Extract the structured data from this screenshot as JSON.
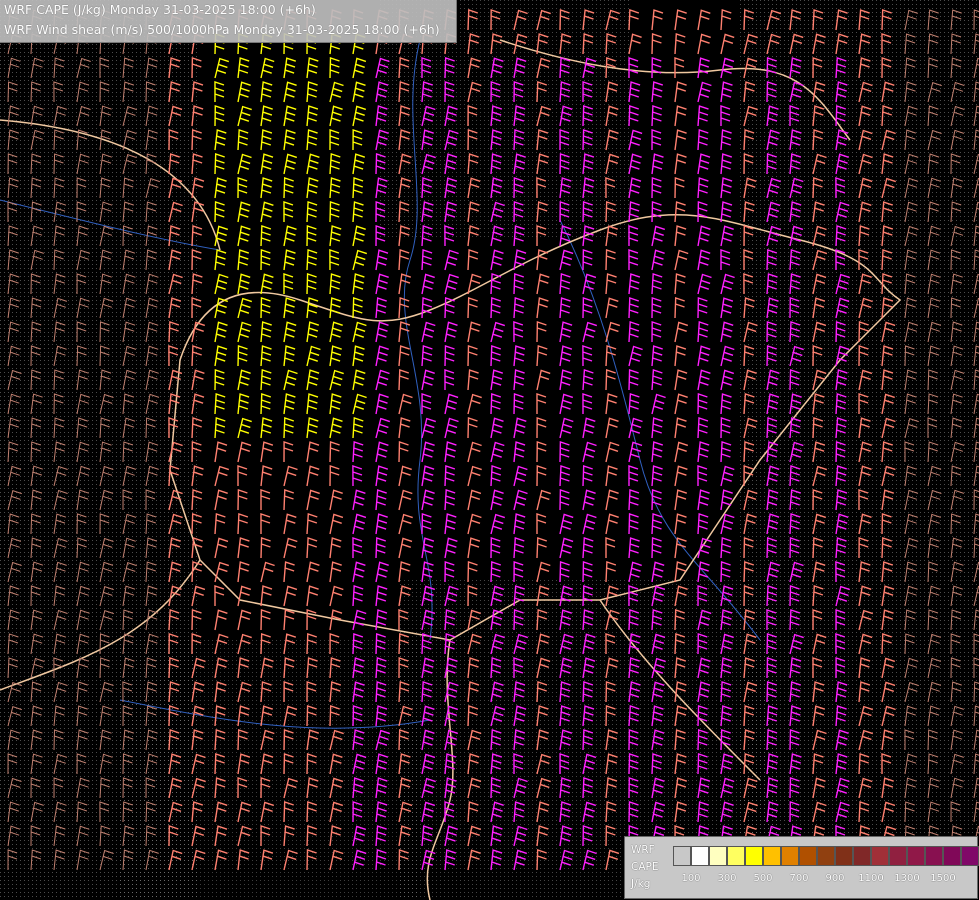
{
  "titles": {
    "line1": "WRF CAPE (J/kg) Monday 31-03-2025 18:00 (+6h)",
    "line2": "WRF Wind shear (m/s) 500/1000hPa Monday 31-03-2025 18:00 (+6h)"
  },
  "legend": {
    "label1": "WRF",
    "label2": "CAPE",
    "label3": "J/kg",
    "colors": [
      "#c8c8c8",
      "#ffffff",
      "#ffffc0",
      "#ffff60",
      "#ffff00",
      "#ffc000",
      "#e08000",
      "#b05000",
      "#904010",
      "#803018",
      "#802828",
      "#a03038",
      "#902040",
      "#901848",
      "#881050",
      "#800858",
      "#800868",
      "#780070"
    ],
    "ticks": [
      "100",
      "300",
      "500",
      "700",
      "900",
      "1100",
      "1300",
      "1500"
    ]
  },
  "colors": {
    "background": "#000000",
    "border_line": "#f0c8a0",
    "river": "#3060c0",
    "shear_low": "#c08070",
    "shear_mid": "#ff8070",
    "shear_high": "#ff20ff",
    "cape_barb": "#ffff00",
    "terrain_contour": "#909090"
  }
}
